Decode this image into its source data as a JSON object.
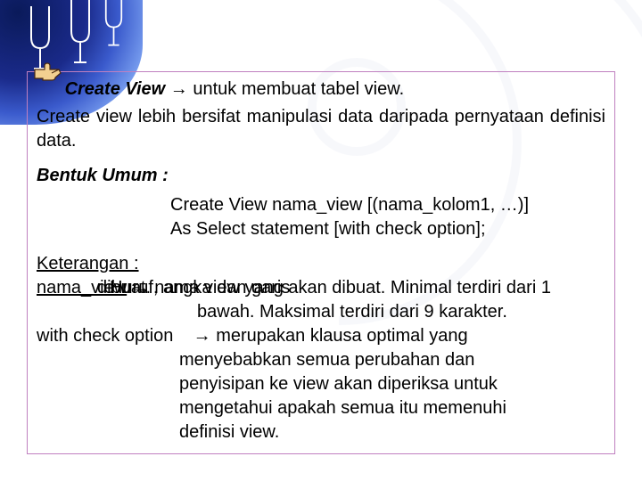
{
  "title": {
    "strong": "Create View",
    "arrow": "→",
    "rest": "untuk membuat tabel view."
  },
  "para1": "Create view lebih bersifat manipulasi data daripada pernyataan definisi data.",
  "bentuk_umum_label": "Bentuk Umum :",
  "syntax": {
    "l1": "Create View nama_view [(nama_kolom1, …)]",
    "l2": "As Select statement [with check option];"
  },
  "keterangan_label": "Keterangan :",
  "row1": {
    "label": "nama_view",
    "overlap_a": "nama view yang akan dibuat. Minimal terdiri dari 1",
    "overlap_b": "dibuat.",
    "overlap_c": "Huruf, angka dan garis",
    "cont": "bawah. Maksimal terdiri dari 9 karakter."
  },
  "row2": {
    "label": "with check option",
    "arrow": "→",
    "l1": "merupakan klausa optimal yang",
    "l2": "menyebabkan semua perubahan dan",
    "l3": "penyisipan ke view akan diperiksa untuk",
    "l4": "mengetahui apakah semua itu memenuhi",
    "l5": "definisi view."
  }
}
